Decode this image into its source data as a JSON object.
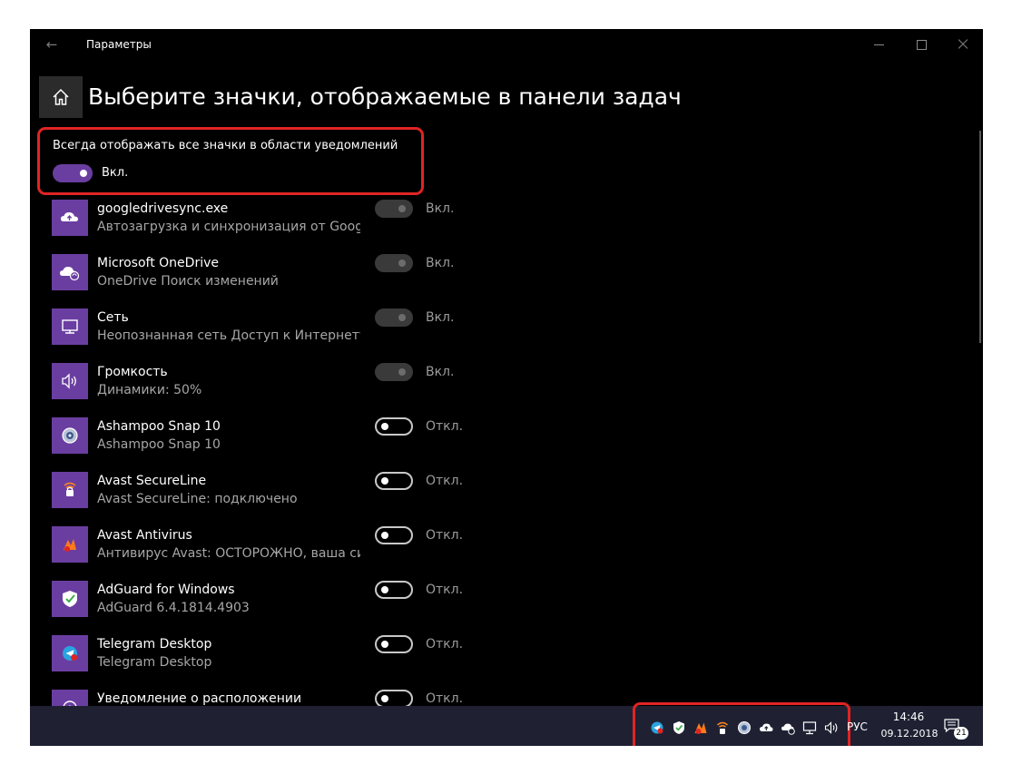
{
  "window": {
    "title": "Параметры",
    "back_icon": "back-arrow-icon"
  },
  "page": {
    "heading": "Выберите значки, отображаемые в панели задач",
    "home_icon": "home-icon"
  },
  "master": {
    "label": "Всегда отображать все значки в области уведомлений",
    "state": "Вкл.",
    "on": true
  },
  "items": [
    {
      "title": "googledrivesync.exe",
      "subtitle": "Автозагрузка и синхронизация от Googl...",
      "state": "Вкл.",
      "on": true,
      "icon": "cloud-upload-icon"
    },
    {
      "title": "Microsoft OneDrive",
      "subtitle": "OneDrive Поиск изменений",
      "state": "Вкл.",
      "on": true,
      "icon": "onedrive-sync-icon"
    },
    {
      "title": "Сеть",
      "subtitle": "Неопознанная сеть Доступ к Интернету...",
      "state": "Вкл.",
      "on": true,
      "icon": "network-icon"
    },
    {
      "title": "Громкость",
      "subtitle": "Динамики: 50%",
      "state": "Вкл.",
      "on": true,
      "icon": "speaker-icon"
    },
    {
      "title": "Ashampoo Snap 10",
      "subtitle": "Ashampoo Snap 10",
      "state": "Откл.",
      "on": false,
      "icon": "ashampoo-snap-icon"
    },
    {
      "title": "Avast SecureLine",
      "subtitle": "Avast SecureLine: подключено",
      "state": "Откл.",
      "on": false,
      "icon": "avast-secureline-icon"
    },
    {
      "title": "Avast Antivirus",
      "subtitle": "Антивирус Avast: ОСТОРОЖНО, ваша сис...",
      "state": "Откл.",
      "on": false,
      "icon": "avast-antivirus-icon"
    },
    {
      "title": "AdGuard for Windows",
      "subtitle": "AdGuard 6.4.1814.4903",
      "state": "Откл.",
      "on": false,
      "icon": "adguard-shield-icon"
    },
    {
      "title": "Telegram Desktop",
      "subtitle": "Telegram Desktop",
      "state": "Откл.",
      "on": false,
      "icon": "telegram-icon"
    },
    {
      "title": "Уведомление о расположении",
      "subtitle": "",
      "state": "Откл.",
      "on": false,
      "icon": "location-icon"
    }
  ],
  "taskbar": {
    "tray_icons": [
      "telegram-icon",
      "adguard-shield-icon",
      "avast-antivirus-icon",
      "avast-secureline-icon",
      "ashampoo-snap-icon",
      "cloud-upload-icon",
      "onedrive-sync-icon",
      "network-icon",
      "speaker-icon"
    ],
    "language": "РУС",
    "time": "14:46",
    "date": "09.12.2018",
    "notification_count": "21",
    "notification_icon": "action-center-icon"
  },
  "colors": {
    "accent": "#6a3ea1",
    "window_bg": "#000000",
    "taskbar_bg": "#1f2133",
    "highlight": "#e02424"
  }
}
